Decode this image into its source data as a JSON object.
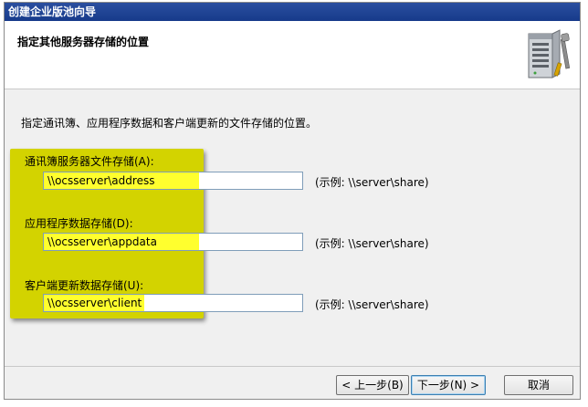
{
  "window": {
    "title": "创建企业版池向导"
  },
  "header": {
    "title": "指定其他服务器存储的位置",
    "icon": "server-tools-icon"
  },
  "intro": "指定通讯簿、应用程序数据和客户端更新的文件存储的位置。",
  "fields": [
    {
      "label": "通讯簿服务器文件存储(A):",
      "value": "\\\\ocsserver\\address",
      "example": "(示例: \\\\server\\share)"
    },
    {
      "label": "应用程序数据存储(D):",
      "value": "\\\\ocsserver\\appdata",
      "example": "(示例: \\\\server\\share)"
    },
    {
      "label": "客户端更新数据存储(U):",
      "value": "\\\\ocsserver\\client",
      "example": "(示例: \\\\server\\share)"
    }
  ],
  "buttons": {
    "back": "< 上一步(B)",
    "next": "下一步(N) >",
    "cancel": "取消"
  },
  "colors": {
    "highlight": "#d3d300",
    "input_highlight": "#ffff2e",
    "titlebar": "#1f4496"
  }
}
